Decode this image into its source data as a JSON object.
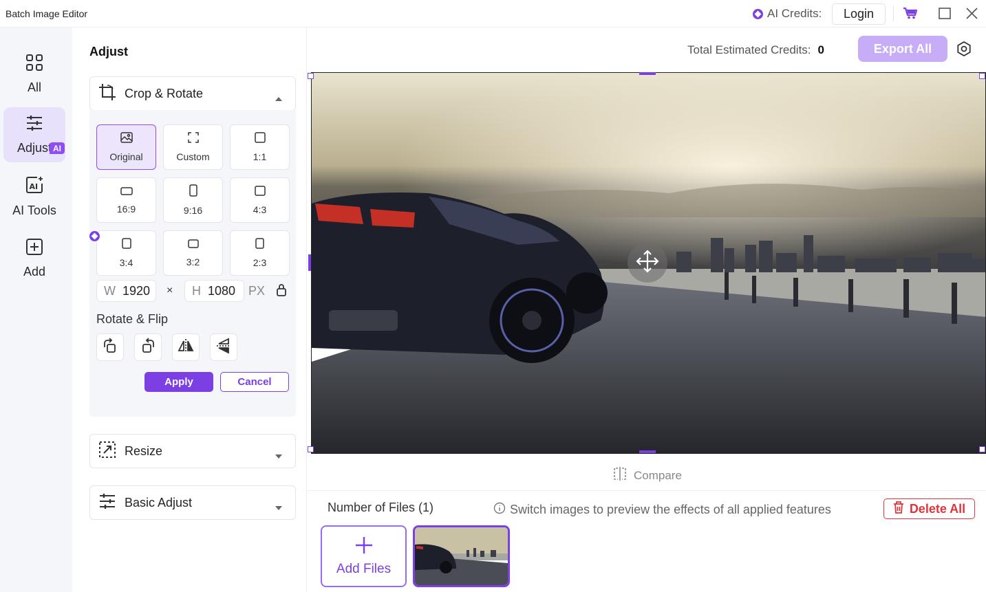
{
  "app": {
    "title": "Batch Image Editor",
    "credits_label": "AI Credits:",
    "login_label": "Login"
  },
  "nav": {
    "items": [
      {
        "label": "All",
        "icon": "grid-icon"
      },
      {
        "label": "Adjust",
        "icon": "sliders-icon"
      },
      {
        "label": "AI Tools",
        "icon": "ai-icon"
      },
      {
        "label": "Add",
        "icon": "plus-square-icon"
      }
    ],
    "ai_badge": "AI"
  },
  "panel": {
    "title": "Adjust",
    "crop_title": "Crop & Rotate",
    "ratios": [
      "Original",
      "Custom",
      "1:1",
      "16:9",
      "9:16",
      "4:3",
      "3:4",
      "3:2",
      "2:3"
    ],
    "selected_ratio": "Original",
    "width_label": "W",
    "width_value": "1920",
    "height_label": "H",
    "height_value": "1080",
    "times": "×",
    "unit": "PX",
    "rotate_flip_title": "Rotate & Flip",
    "apply_label": "Apply",
    "cancel_label": "Cancel",
    "resize_title": "Resize",
    "basic_adjust_title": "Basic Adjust"
  },
  "main": {
    "total_credits_label": "Total Estimated Credits:",
    "total_credits_value": "0",
    "export_label": "Export All",
    "compare_label": "Compare",
    "file_count_label": "Number of Files (1)",
    "switch_tip": "Switch images to preview the effects of all applied features",
    "delete_label": "Delete All",
    "add_files_label": "Add Files"
  },
  "colors": {
    "accent": "#7b3fe4",
    "accent_light": "#ece5fc",
    "danger": "#e0353b"
  }
}
